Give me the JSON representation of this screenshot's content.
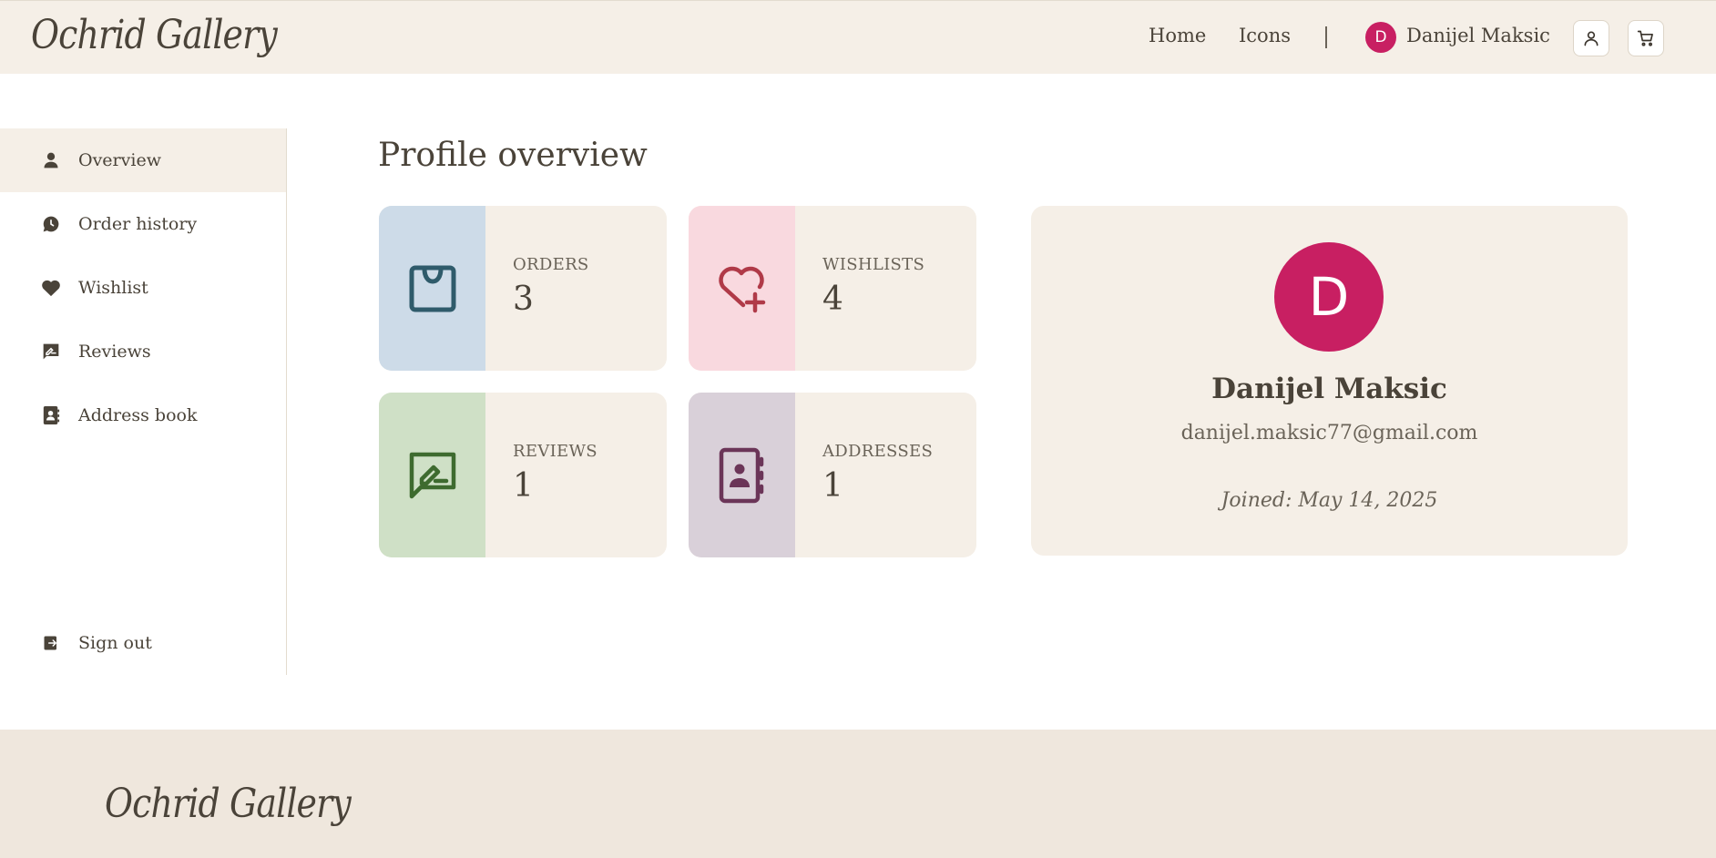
{
  "header": {
    "logo": "Ochrid Gallery",
    "nav": {
      "home": "Home",
      "icons": "Icons"
    },
    "user": {
      "initial": "D",
      "name": "Danijel Maksic"
    },
    "icons": {
      "profile": "user-icon",
      "cart": "cart-icon"
    }
  },
  "sidebar": {
    "items": [
      {
        "label": "Overview",
        "icon": "user-icon",
        "active": true
      },
      {
        "label": "Order history",
        "icon": "history-icon",
        "active": false
      },
      {
        "label": "Wishlist",
        "icon": "heart-icon",
        "active": false
      },
      {
        "label": "Reviews",
        "icon": "review-icon",
        "active": false
      },
      {
        "label": "Address book",
        "icon": "address-book-icon",
        "active": false
      }
    ],
    "sign_out": {
      "label": "Sign out",
      "icon": "sign-out-icon"
    }
  },
  "main": {
    "title": "Profile overview",
    "stats": [
      {
        "label": "ORDERS",
        "value": "3",
        "icon": "shopping-bag-icon",
        "band_color": "#cddbe8",
        "icon_color": "#2f5b6b"
      },
      {
        "label": "WISHLISTS",
        "value": "4",
        "icon": "heart-plus-icon",
        "band_color": "#f9d9df",
        "icon_color": "#b03a48"
      },
      {
        "label": "REVIEWS",
        "value": "1",
        "icon": "review-icon",
        "band_color": "#cfe0c6",
        "icon_color": "#3e6b2f"
      },
      {
        "label": "ADDRESSES",
        "value": "1",
        "icon": "address-book-icon",
        "band_color": "#d9d0d9",
        "icon_color": "#6b3558"
      }
    ],
    "profile": {
      "initial": "D",
      "name": "Danijel Maksic",
      "email": "danijel.maksic77@gmail.com",
      "joined": "Joined: May 14, 2025"
    }
  },
  "footer": {
    "logo": "Ochrid Gallery"
  },
  "colors": {
    "accent": "#c81f62",
    "cream": "#f5efe7",
    "text": "#4a4339"
  }
}
